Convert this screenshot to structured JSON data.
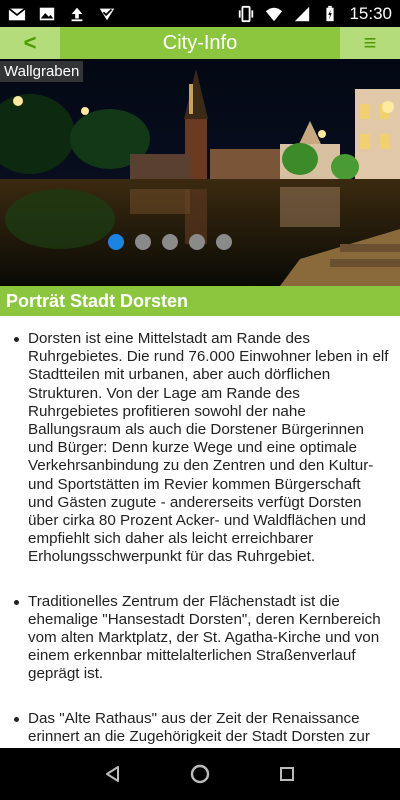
{
  "status_bar": {
    "time": "15:30",
    "left_icons": [
      "gmail-icon",
      "image-icon",
      "upload-icon",
      "check-mail-icon"
    ],
    "right_icons": [
      "vibrate-icon",
      "wifi-icon",
      "signal-icon",
      "battery-charging-icon"
    ]
  },
  "header": {
    "back_label": "<",
    "title": "City-Info",
    "menu_label": "≡"
  },
  "slider": {
    "caption": "Wallgraben",
    "total_slides": 5,
    "active_slide": 1
  },
  "section": {
    "title": "Porträt Stadt Dorsten"
  },
  "content": {
    "paragraphs": [
      "Dorsten ist eine Mittelstadt am Rande des Ruhrgebietes. Die rund 76.000 Einwohner leben in elf Stadtteilen mit urbanen, aber auch dörflichen Strukturen. Von der Lage am Rande des Ruhrgebietes profitieren sowohl der nahe Ballungsraum als auch die Dorstener Bürgerinnen und Bürger: Denn kurze Wege und eine optimale Verkehrsanbindung zu den Zentren und den Kultur- und Sportstätten im Revier kommen Bürgerschaft und Gästen zugute - andererseits verfügt Dorsten über cirka 80 Prozent Acker- und Waldflächen und empfiehlt sich daher als leicht erreichbarer Erholungsschwerpunkt für das Ruhrgebiet.",
      "Traditionelles Zentrum der Flächenstadt ist die ehemalige \"Hansestadt Dorsten\", deren Kernbereich vom alten Marktplatz, der St. Agatha-Kirche und von einem erkennbar mittelalterlichen Straßenverlauf geprägt ist.",
      "Das \"Alte Rathaus\" aus der Zeit der Renaissance erinnert an die Zugehörigkeit der Stadt Dorsten zur Hanse und dominiert den Marktplatz im Kern der Altstadt. Gassen und Gässchen führen auf den"
    ]
  },
  "nav_bar": {
    "buttons": [
      "back-nav-icon",
      "home-nav-icon",
      "recents-nav-icon"
    ]
  },
  "colors": {
    "accent_green": "#8cc63f",
    "header_button_bg": "#b5dc7a",
    "dot_active": "#1a84e0",
    "dot_inactive": "#8a8a8a"
  }
}
